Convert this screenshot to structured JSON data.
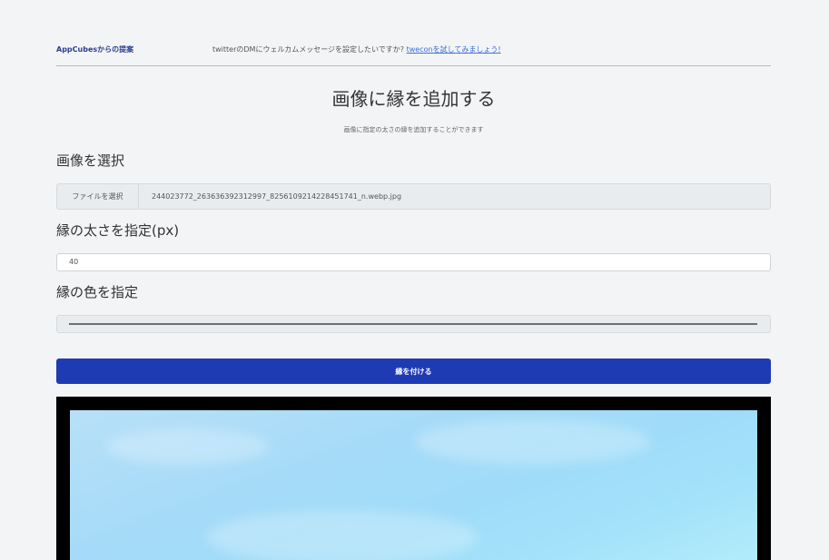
{
  "header": {
    "brand": "AppCubesからの提案",
    "promo_text": "twitterのDMにウェルカムメッセージを設定したいですか? ",
    "promo_link": "tweconを試してみましょう!"
  },
  "page": {
    "title": "画像に縁を追加する",
    "subtitle": "画像に指定の太さの縁を追加することができます"
  },
  "form": {
    "image_label": "画像を選択",
    "file_button_label": "ファイルを選択",
    "file_name": "244023772_263636392312997_8256109214228451741_n.webp.jpg",
    "thickness_label": "縁の太さを指定(px)",
    "thickness_value": "40",
    "color_label": "縁の色を指定",
    "color_value": "#6b6f73",
    "submit_label": "縁を付ける"
  },
  "preview": {
    "border_color": "#000000",
    "border_px": 40
  }
}
